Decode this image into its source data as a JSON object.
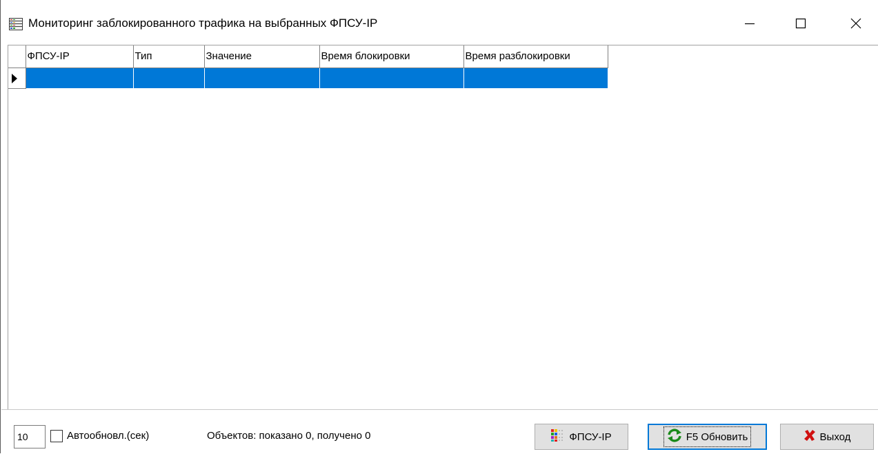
{
  "window": {
    "title": "Мониторинг заблокированного трафика на выбранных ФПСУ-IP"
  },
  "grid": {
    "columns": [
      "ФПСУ-IP",
      "Тип",
      "Значение",
      "Время блокировки",
      "Время разблокировки"
    ],
    "selected_row_color": "#0078d7"
  },
  "bottom": {
    "interval_value": "10",
    "auto_refresh_label": "Автообновл.(сек)",
    "auto_refresh_checked": false,
    "objects_text": "Объектов: показано 0,   получено 0",
    "fpsu_button_label": "ФПСУ-IP",
    "refresh_button_label": "F5 Обновить",
    "exit_button_label": "Выход"
  },
  "icons": {
    "app": "server-rack-icon",
    "minimize": "minimize-icon",
    "maximize": "maximize-icon",
    "close": "close-icon",
    "fpsu": "color-grid-icon",
    "refresh": "refresh-icon",
    "exit": "red-x-icon"
  }
}
